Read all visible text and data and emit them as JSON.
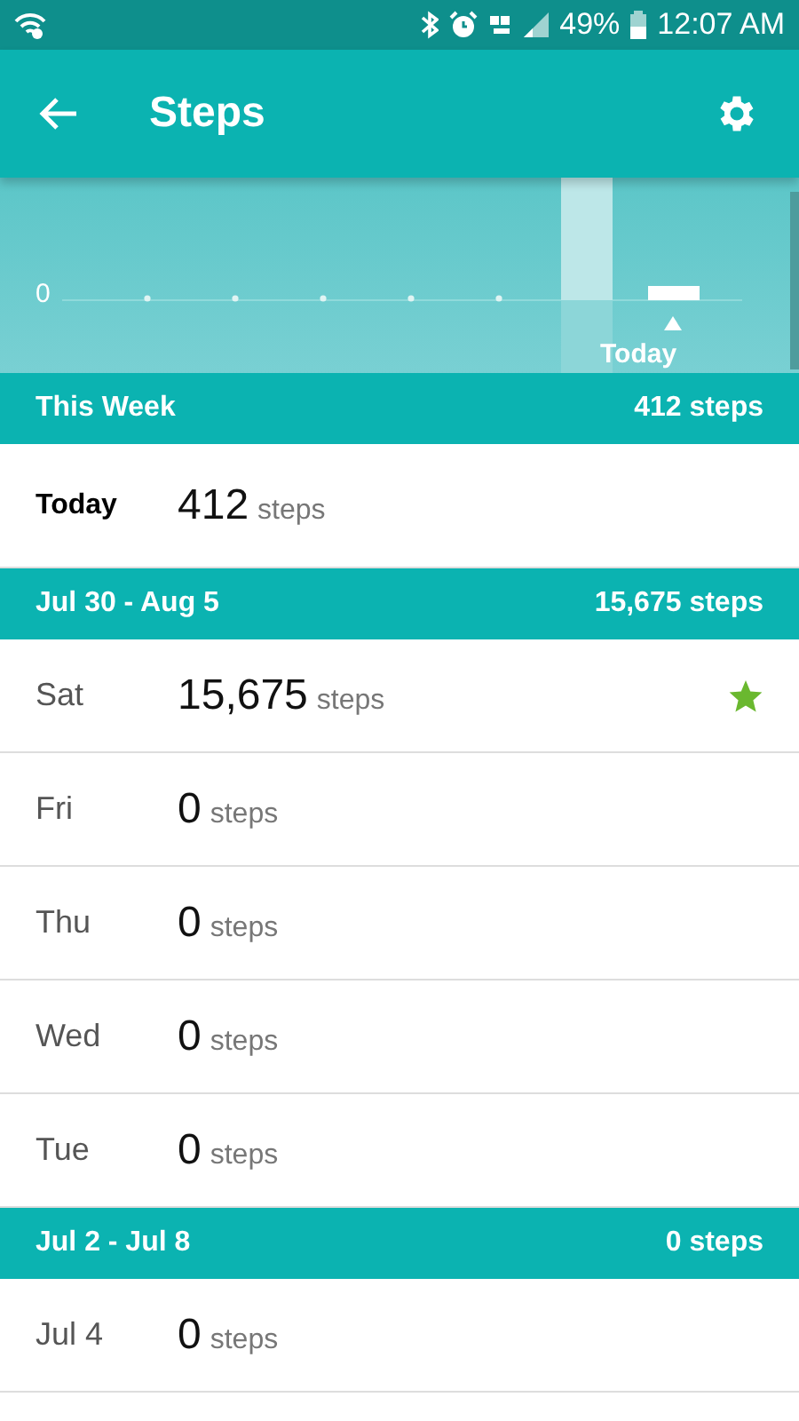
{
  "status_bar": {
    "battery": "49%",
    "time": "12:07 AM"
  },
  "app_bar": {
    "title": "Steps"
  },
  "chart": {
    "zero_label": "0",
    "today_label": "Today"
  },
  "sections": [
    {
      "label": "This Week",
      "total": "412 steps",
      "rows": [
        {
          "day": "Today",
          "count": "412",
          "unit": "steps",
          "current": true,
          "goal_met": false
        }
      ]
    },
    {
      "label": "Jul 30 - Aug 5",
      "total": "15,675 steps",
      "rows": [
        {
          "day": "Sat",
          "count": "15,675",
          "unit": "steps",
          "current": false,
          "goal_met": true
        },
        {
          "day": "Fri",
          "count": "0",
          "unit": "steps",
          "current": false,
          "goal_met": false
        },
        {
          "day": "Thu",
          "count": "0",
          "unit": "steps",
          "current": false,
          "goal_met": false
        },
        {
          "day": "Wed",
          "count": "0",
          "unit": "steps",
          "current": false,
          "goal_met": false
        },
        {
          "day": "Tue",
          "count": "0",
          "unit": "steps",
          "current": false,
          "goal_met": false
        }
      ]
    },
    {
      "label": "Jul 2 - Jul 8",
      "total": "0 steps",
      "rows": [
        {
          "day": "Jul 4",
          "count": "0",
          "unit": "steps",
          "current": false,
          "goal_met": false
        }
      ]
    }
  ]
}
